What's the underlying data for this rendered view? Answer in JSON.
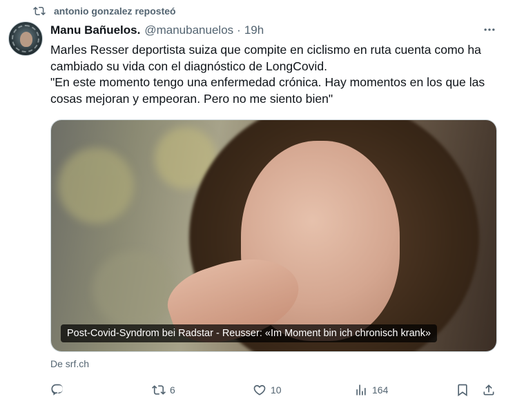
{
  "repost": {
    "icon": "repost-icon",
    "text": "antonio gonzalez reposteó"
  },
  "author": {
    "name": "Manu Bañuelos.",
    "handle": "@manubanuelos",
    "separator": "·",
    "time": "19h",
    "avatar_icon": "avatar-image"
  },
  "tweet": {
    "lines": [
      "Marles Resser deportista suiza que compite en ciclismo en ruta cuenta como ha cambiado su vida con el diagnóstico de LongCovid.",
      "\"En este momento tengo una enfermedad crónica. Hay momentos en los que las cosas mejoran y empeoran. Pero no me siento bien\""
    ]
  },
  "media": {
    "caption": "Post-Covid-Syndrom bei Radstar - Reusser: «Im Moment bin ich chronisch krank»",
    "source": "De srf.ch"
  },
  "actions": {
    "reply": {
      "icon": "reply-icon",
      "count": ""
    },
    "repost": {
      "icon": "repost-icon",
      "count": "6"
    },
    "like": {
      "icon": "heart-icon",
      "count": "10"
    },
    "views": {
      "icon": "views-icon",
      "count": "164"
    },
    "bookmark": {
      "icon": "bookmark-icon"
    },
    "share": {
      "icon": "share-icon"
    }
  },
  "colors": {
    "text": "#0f1419",
    "muted": "#536471",
    "border": "#cfd9de"
  }
}
